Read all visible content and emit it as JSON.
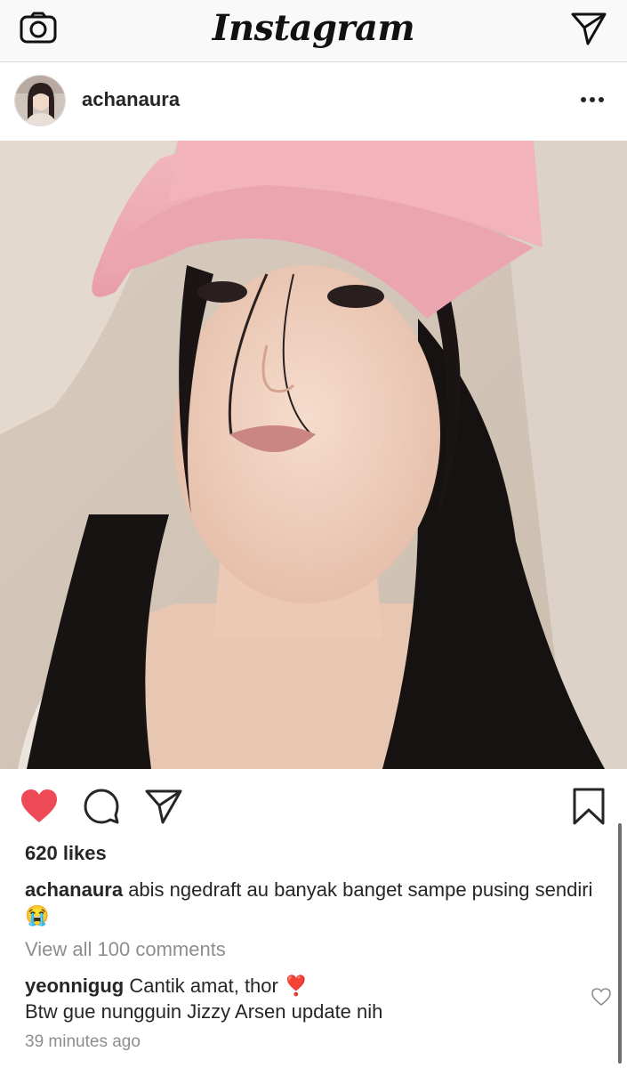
{
  "topbar": {
    "logo": "Instagram",
    "camera_icon": "camera-icon",
    "direct_icon": "paper-plane-icon"
  },
  "post": {
    "username": "achanaura",
    "avatar_icon": "profile-photo",
    "more_icon": "more-horizontal-icon",
    "photo": "selfie photo of a woman in a pink cap",
    "liked": true,
    "likes_text": "620 likes",
    "caption_user": "achanaura",
    "caption_text": "abis ngedraft au banyak banget sampe pusing sendiri 😭",
    "view_comments": "View all 100 comments",
    "comment_user": "yeonnigug",
    "comment_text": "Cantik amat, thor ❣️",
    "comment_text_2": "Btw gue nungguin Jizzy Arsen update nih",
    "timestamp": "39 minutes ago"
  },
  "colors": {
    "like_red": "#ed4956",
    "muted": "#8e8e8e",
    "text": "#262626"
  }
}
